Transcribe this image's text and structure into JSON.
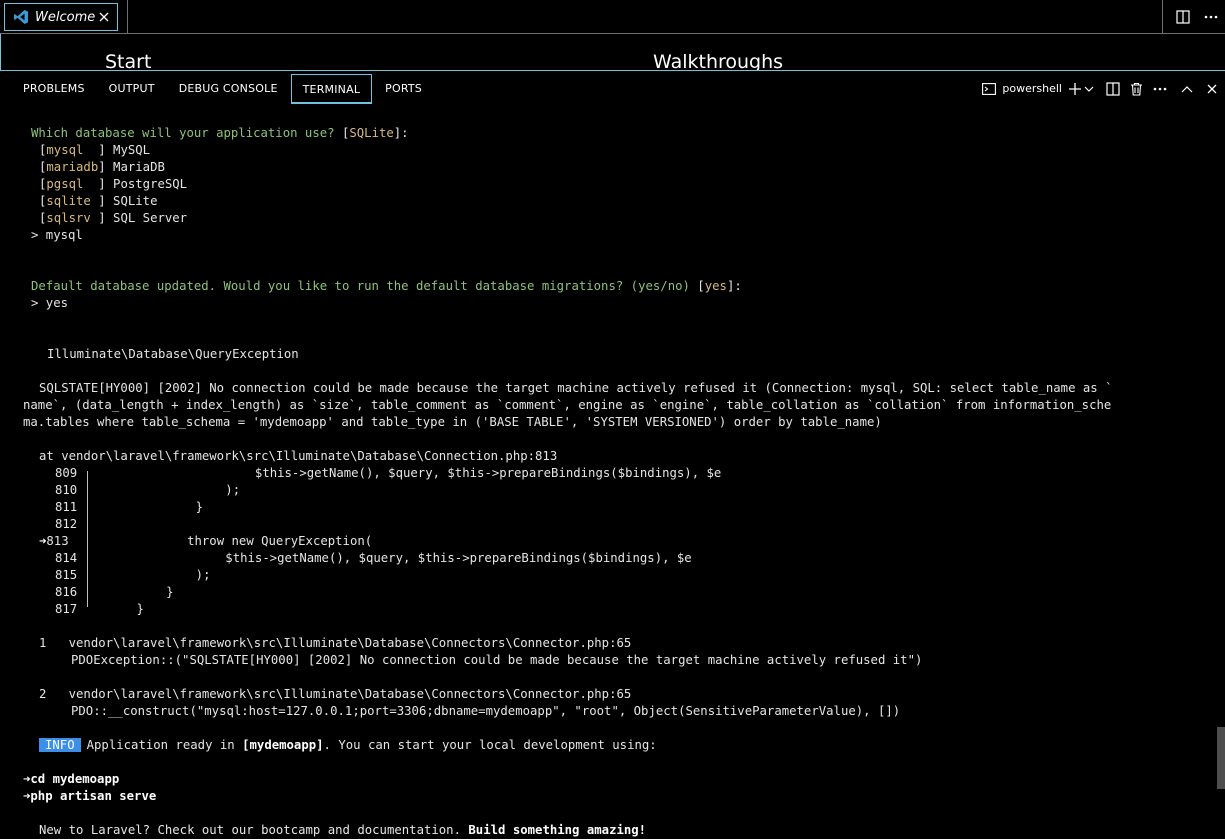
{
  "tab": {
    "label": "Welcome",
    "close_icon": "close-icon",
    "app_icon": "vscode-icon"
  },
  "editor_actions": {
    "split_icon": "split-editor-icon",
    "more_icon": "more-actions-icon"
  },
  "welcome_peek": {
    "start": "Start",
    "walkthroughs": "Walkthroughs"
  },
  "panel": {
    "tabs": [
      "PROBLEMS",
      "OUTPUT",
      "DEBUG CONSOLE",
      "TERMINAL",
      "PORTS"
    ],
    "active_tab": "TERMINAL",
    "shell_label": "powershell"
  },
  "colors": {
    "accent": "#6fc3df",
    "green": "#8ec17a",
    "yellow": "#d7ba7d",
    "info": "#3b8eea"
  },
  "terminal": {
    "q1": "Which database will your application use?",
    "q1_default": "SQLite",
    "options": [
      {
        "key": "mysql  ",
        "label": "MySQL"
      },
      {
        "key": "mariadb",
        "label": "MariaDB"
      },
      {
        "key": "pgsql  ",
        "label": "PostgreSQL"
      },
      {
        "key": "sqlite ",
        "label": "SQLite"
      },
      {
        "key": "sqlsrv ",
        "label": "SQL Server"
      }
    ],
    "answer1": "> mysql",
    "q2": "Default database updated. Would you like to run the default database migrations? (yes/no)",
    "q2_default": "yes",
    "answer2": "> yes",
    "exception": "Illuminate\\Database\\QueryException",
    "sqlstate_1": "SQLSTATE[HY000] [2002] No connection could be made because the target machine actively refused it (Connection: mysql, SQL: select table_name as `",
    "sqlstate_2": "name`, (data_length + index_length) as `size`, table_comment as `comment`, engine as `engine`, table_collation as `collation` from information_sche",
    "sqlstate_3": "ma.tables where table_schema = 'mydemoapp' and table_type in ('BASE TABLE', 'SYSTEM VERSIONED') order by table_name)",
    "at_line": "at vendor\\laravel\\framework\\src\\Illuminate\\Database\\Connection.php:813",
    "code": [
      {
        "num": "809",
        "text": "                    $this->getName(), $query, $this->prepareBindings($bindings), $e"
      },
      {
        "num": "810",
        "text": "                );"
      },
      {
        "num": "811",
        "text": "            }"
      },
      {
        "num": "812",
        "text": ""
      },
      {
        "num": "813",
        "text": "            throw new QueryException("
      },
      {
        "num": "814",
        "text": "                $this->getName(), $query, $this->prepareBindings($bindings), $e"
      },
      {
        "num": "815",
        "text": "            );"
      },
      {
        "num": "816",
        "text": "        }"
      },
      {
        "num": "817",
        "text": "    }"
      }
    ],
    "arrow_marker": "➜",
    "frame1_num": "1",
    "frame1_path": "vendor\\laravel\\framework\\src\\Illuminate\\Database\\Connectors\\Connector.php:65",
    "frame1_call": "PDOException::(\"SQLSTATE[HY000] [2002] No connection could be made because the target machine actively refused it\")",
    "frame2_num": "2",
    "frame2_path": "vendor\\laravel\\framework\\src\\Illuminate\\Database\\Connectors\\Connector.php:65",
    "frame2_call": "PDO::__construct(\"mysql:host=127.0.0.1;port=3306;dbname=mydemoapp\", \"root\", Object(SensitiveParameterValue), [])",
    "info_badge": "INFO",
    "info_pre": "Application ready in",
    "info_app": "[mydemoapp]",
    "info_post": ". You can start your local development using:",
    "cmd1": "cd mydemoapp",
    "cmd2": "php artisan serve",
    "footer_pre": "New to Laravel? Check out our bootcamp and documentation.",
    "footer_bold": "Build something amazing!"
  }
}
